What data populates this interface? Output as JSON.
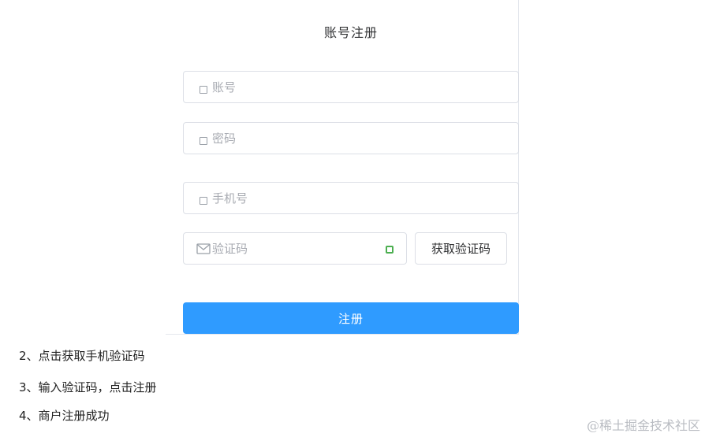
{
  "form": {
    "title": "账号注册",
    "account_placeholder": "账号",
    "password_placeholder": "密码",
    "phone_placeholder": "手机号",
    "code_placeholder": "验证码",
    "get_code_label": "获取验证码",
    "register_label": "注册"
  },
  "steps": [
    "2、点击获取手机验证码",
    "3、输入验证码，点击注册",
    "4、商户注册成功"
  ],
  "watermark": "@稀土掘金技术社区",
  "colors": {
    "primary": "#2f9bff",
    "border": "#dcdfe6",
    "placeholder": "#a8abb2",
    "captcha_indicator": "#4caf50"
  }
}
